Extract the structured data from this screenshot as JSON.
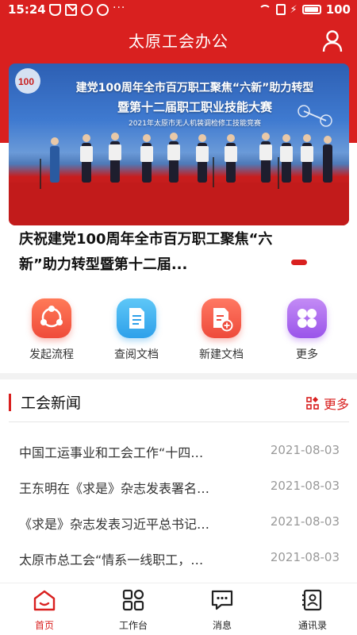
{
  "status_bar": {
    "time": "15:24",
    "battery": "100",
    "more": "···"
  },
  "header": {
    "title": "太原工会办公"
  },
  "banner": {
    "line1": "建党100周年全市百万职工聚焦“六新”助力转型",
    "line2": "暨第十二届职工职业技能大赛",
    "line3": "2021年太原市无人机装调检修工技能竞赛",
    "caption": "庆祝建党100周年全市百万职工聚焦“六新”助力转型暨第十二届..."
  },
  "shortcuts": [
    {
      "label": "发起流程",
      "icon": "share-flow-icon"
    },
    {
      "label": "查阅文档",
      "icon": "document-icon"
    },
    {
      "label": "新建文档",
      "icon": "new-document-icon"
    },
    {
      "label": "更多",
      "icon": "clover-icon"
    }
  ],
  "news_section": {
    "title": "工会新闻",
    "more": "更多",
    "items": [
      {
        "title": "中国工运事业和工会工作“十四…",
        "date": "2021-08-03"
      },
      {
        "title": "王东明在《求是》杂志发表署名…",
        "date": "2021-08-03"
      },
      {
        "title": "《求是》杂志发表习近平总书记…",
        "date": "2021-08-03"
      },
      {
        "title": "太原市总工会“情系一线职工，…",
        "date": "2021-08-03"
      }
    ]
  },
  "bottom_nav": [
    {
      "label": "首页",
      "icon": "home-icon",
      "active": true
    },
    {
      "label": "工作台",
      "icon": "grid-icon",
      "active": false
    },
    {
      "label": "消息",
      "icon": "message-icon",
      "active": false
    },
    {
      "label": "通讯录",
      "icon": "contacts-icon",
      "active": false
    }
  ],
  "colors": {
    "brand_red": "#d9201f"
  }
}
